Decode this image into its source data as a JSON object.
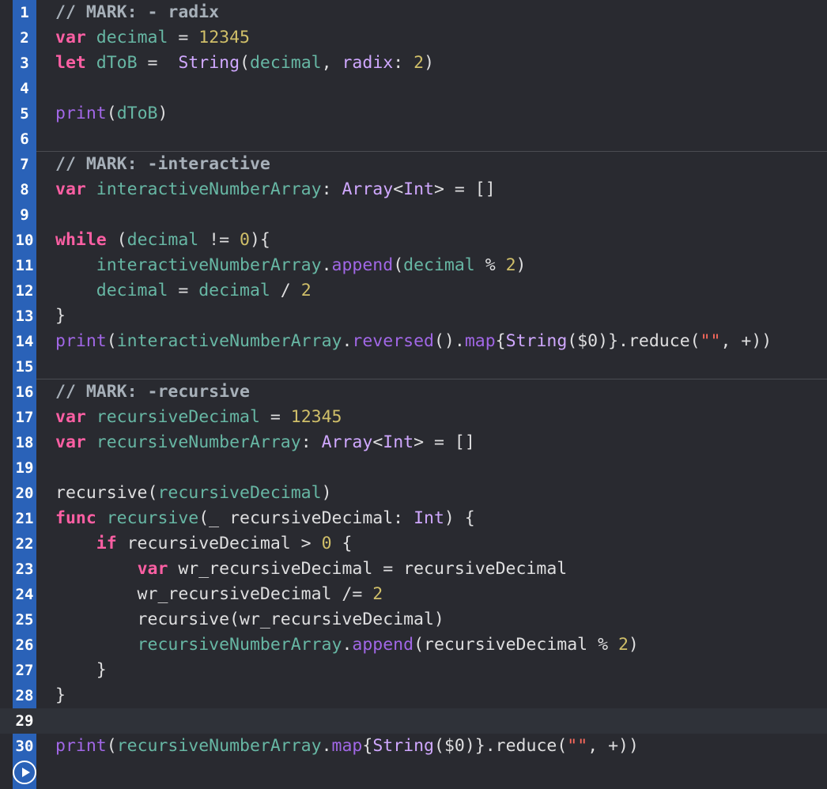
{
  "editor": {
    "current_line": 29,
    "separators_after": [
      6,
      15
    ],
    "lines": [
      {
        "n": "1",
        "tokens": [
          {
            "t": "// MARK: - radix",
            "c": "cmt"
          }
        ]
      },
      {
        "n": "2",
        "tokens": [
          {
            "t": "var",
            "c": "kw"
          },
          {
            "t": " ",
            "c": "pl"
          },
          {
            "t": "decimal",
            "c": "prj"
          },
          {
            "t": " = ",
            "c": "pl"
          },
          {
            "t": "12345",
            "c": "num"
          }
        ]
      },
      {
        "n": "3",
        "tokens": [
          {
            "t": "let",
            "c": "kw"
          },
          {
            "t": " ",
            "c": "pl"
          },
          {
            "t": "dToB",
            "c": "prj"
          },
          {
            "t": " =  ",
            "c": "pl"
          },
          {
            "t": "String",
            "c": "sys"
          },
          {
            "t": "(",
            "c": "pl"
          },
          {
            "t": "decimal",
            "c": "prj"
          },
          {
            "t": ", ",
            "c": "pl"
          },
          {
            "t": "radix",
            "c": "sys"
          },
          {
            "t": ": ",
            "c": "pl"
          },
          {
            "t": "2",
            "c": "num"
          },
          {
            "t": ")",
            "c": "pl"
          }
        ]
      },
      {
        "n": "4",
        "tokens": []
      },
      {
        "n": "5",
        "tokens": [
          {
            "t": "print",
            "c": "fn"
          },
          {
            "t": "(",
            "c": "pl"
          },
          {
            "t": "dToB",
            "c": "prj"
          },
          {
            "t": ")",
            "c": "pl"
          }
        ]
      },
      {
        "n": "6",
        "tokens": []
      },
      {
        "n": "7",
        "tokens": [
          {
            "t": "// MARK: -interactive",
            "c": "cmt"
          }
        ]
      },
      {
        "n": "8",
        "tokens": [
          {
            "t": "var",
            "c": "kw"
          },
          {
            "t": " ",
            "c": "pl"
          },
          {
            "t": "interactiveNumberArray",
            "c": "prj"
          },
          {
            "t": ": ",
            "c": "pl"
          },
          {
            "t": "Array",
            "c": "sys"
          },
          {
            "t": "<",
            "c": "pl"
          },
          {
            "t": "Int",
            "c": "sys"
          },
          {
            "t": "> = []",
            "c": "pl"
          }
        ]
      },
      {
        "n": "9",
        "tokens": []
      },
      {
        "n": "10",
        "tokens": [
          {
            "t": "while",
            "c": "kw"
          },
          {
            "t": " (",
            "c": "pl"
          },
          {
            "t": "decimal",
            "c": "prj"
          },
          {
            "t": " != ",
            "c": "pl"
          },
          {
            "t": "0",
            "c": "num"
          },
          {
            "t": "){",
            "c": "pl"
          }
        ]
      },
      {
        "n": "11",
        "tokens": [
          {
            "t": "    ",
            "c": "pl"
          },
          {
            "t": "interactiveNumberArray",
            "c": "prj"
          },
          {
            "t": ".",
            "c": "pl"
          },
          {
            "t": "append",
            "c": "fn"
          },
          {
            "t": "(",
            "c": "pl"
          },
          {
            "t": "decimal",
            "c": "prj"
          },
          {
            "t": " % ",
            "c": "pl"
          },
          {
            "t": "2",
            "c": "num"
          },
          {
            "t": ")",
            "c": "pl"
          }
        ]
      },
      {
        "n": "12",
        "tokens": [
          {
            "t": "    ",
            "c": "pl"
          },
          {
            "t": "decimal",
            "c": "prj"
          },
          {
            "t": " = ",
            "c": "pl"
          },
          {
            "t": "decimal",
            "c": "prj"
          },
          {
            "t": " / ",
            "c": "pl"
          },
          {
            "t": "2",
            "c": "num"
          }
        ]
      },
      {
        "n": "13",
        "tokens": [
          {
            "t": "}",
            "c": "pl"
          }
        ]
      },
      {
        "n": "14",
        "tokens": [
          {
            "t": "print",
            "c": "fn"
          },
          {
            "t": "(",
            "c": "pl"
          },
          {
            "t": "interactiveNumberArray",
            "c": "prj"
          },
          {
            "t": ".",
            "c": "pl"
          },
          {
            "t": "reversed",
            "c": "fn"
          },
          {
            "t": "().",
            "c": "pl"
          },
          {
            "t": "map",
            "c": "fn"
          },
          {
            "t": "{",
            "c": "pl"
          },
          {
            "t": "String",
            "c": "sys"
          },
          {
            "t": "($0)}.",
            "c": "pl"
          },
          {
            "t": "reduce",
            "c": "pl"
          },
          {
            "t": "(",
            "c": "pl"
          },
          {
            "t": "\"\"",
            "c": "str"
          },
          {
            "t": ", +))",
            "c": "pl"
          }
        ]
      },
      {
        "n": "15",
        "tokens": []
      },
      {
        "n": "16",
        "tokens": [
          {
            "t": "// MARK: -recursive",
            "c": "cmt"
          }
        ]
      },
      {
        "n": "17",
        "tokens": [
          {
            "t": "var",
            "c": "kw"
          },
          {
            "t": " ",
            "c": "pl"
          },
          {
            "t": "recursiveDecimal",
            "c": "prj"
          },
          {
            "t": " = ",
            "c": "pl"
          },
          {
            "t": "12345",
            "c": "num"
          }
        ]
      },
      {
        "n": "18",
        "tokens": [
          {
            "t": "var",
            "c": "kw"
          },
          {
            "t": " ",
            "c": "pl"
          },
          {
            "t": "recursiveNumberArray",
            "c": "prj"
          },
          {
            "t": ": ",
            "c": "pl"
          },
          {
            "t": "Array",
            "c": "sys"
          },
          {
            "t": "<",
            "c": "pl"
          },
          {
            "t": "Int",
            "c": "sys"
          },
          {
            "t": "> = []",
            "c": "pl"
          }
        ]
      },
      {
        "n": "19",
        "tokens": []
      },
      {
        "n": "20",
        "tokens": [
          {
            "t": "recursive",
            "c": "pl"
          },
          {
            "t": "(",
            "c": "pl"
          },
          {
            "t": "recursiveDecimal",
            "c": "prj"
          },
          {
            "t": ")",
            "c": "pl"
          }
        ]
      },
      {
        "n": "21",
        "tokens": [
          {
            "t": "func",
            "c": "kw"
          },
          {
            "t": " ",
            "c": "pl"
          },
          {
            "t": "recursive",
            "c": "prj"
          },
          {
            "t": "(_ recursiveDecimal: ",
            "c": "pl"
          },
          {
            "t": "Int",
            "c": "sys"
          },
          {
            "t": ") {",
            "c": "pl"
          }
        ]
      },
      {
        "n": "22",
        "tokens": [
          {
            "t": "    ",
            "c": "pl"
          },
          {
            "t": "if",
            "c": "kw"
          },
          {
            "t": " recursiveDecimal > ",
            "c": "pl"
          },
          {
            "t": "0",
            "c": "num"
          },
          {
            "t": " {",
            "c": "pl"
          }
        ]
      },
      {
        "n": "23",
        "tokens": [
          {
            "t": "        ",
            "c": "pl"
          },
          {
            "t": "var",
            "c": "kw"
          },
          {
            "t": " wr_recursiveDecimal = recursiveDecimal",
            "c": "pl"
          }
        ]
      },
      {
        "n": "24",
        "tokens": [
          {
            "t": "        wr_recursiveDecimal /= ",
            "c": "pl"
          },
          {
            "t": "2",
            "c": "num"
          }
        ]
      },
      {
        "n": "25",
        "tokens": [
          {
            "t": "        recursive(wr_recursiveDecimal)",
            "c": "pl"
          }
        ]
      },
      {
        "n": "26",
        "tokens": [
          {
            "t": "        ",
            "c": "pl"
          },
          {
            "t": "recursiveNumberArray",
            "c": "prj"
          },
          {
            "t": ".",
            "c": "pl"
          },
          {
            "t": "append",
            "c": "fn"
          },
          {
            "t": "(recursiveDecimal % ",
            "c": "pl"
          },
          {
            "t": "2",
            "c": "num"
          },
          {
            "t": ")",
            "c": "pl"
          }
        ]
      },
      {
        "n": "27",
        "tokens": [
          {
            "t": "    }",
            "c": "pl"
          }
        ]
      },
      {
        "n": "28",
        "tokens": [
          {
            "t": "}",
            "c": "pl"
          }
        ]
      },
      {
        "n": "29",
        "tokens": []
      },
      {
        "n": "30",
        "tokens": [
          {
            "t": "print",
            "c": "fn"
          },
          {
            "t": "(",
            "c": "pl"
          },
          {
            "t": "recursiveNumberArray",
            "c": "prj"
          },
          {
            "t": ".",
            "c": "pl"
          },
          {
            "t": "map",
            "c": "fn"
          },
          {
            "t": "{",
            "c": "pl"
          },
          {
            "t": "String",
            "c": "sys"
          },
          {
            "t": "($0)}.",
            "c": "pl"
          },
          {
            "t": "reduce",
            "c": "pl"
          },
          {
            "t": "(",
            "c": "pl"
          },
          {
            "t": "\"\"",
            "c": "str"
          },
          {
            "t": ", +))",
            "c": "pl"
          }
        ]
      }
    ]
  },
  "run_button": {
    "icon": "play-icon"
  },
  "colors": {
    "background": "#292a30",
    "gutter": "#2a62b8",
    "keyword": "#fc5fa3",
    "number": "#d0bf69",
    "project_identifier": "#67b7a4",
    "function": "#a167e6",
    "system_type": "#d0a8ff",
    "comment": "#a7b0b9",
    "string": "#fc6a5d",
    "plain": "#dfdfe0"
  }
}
